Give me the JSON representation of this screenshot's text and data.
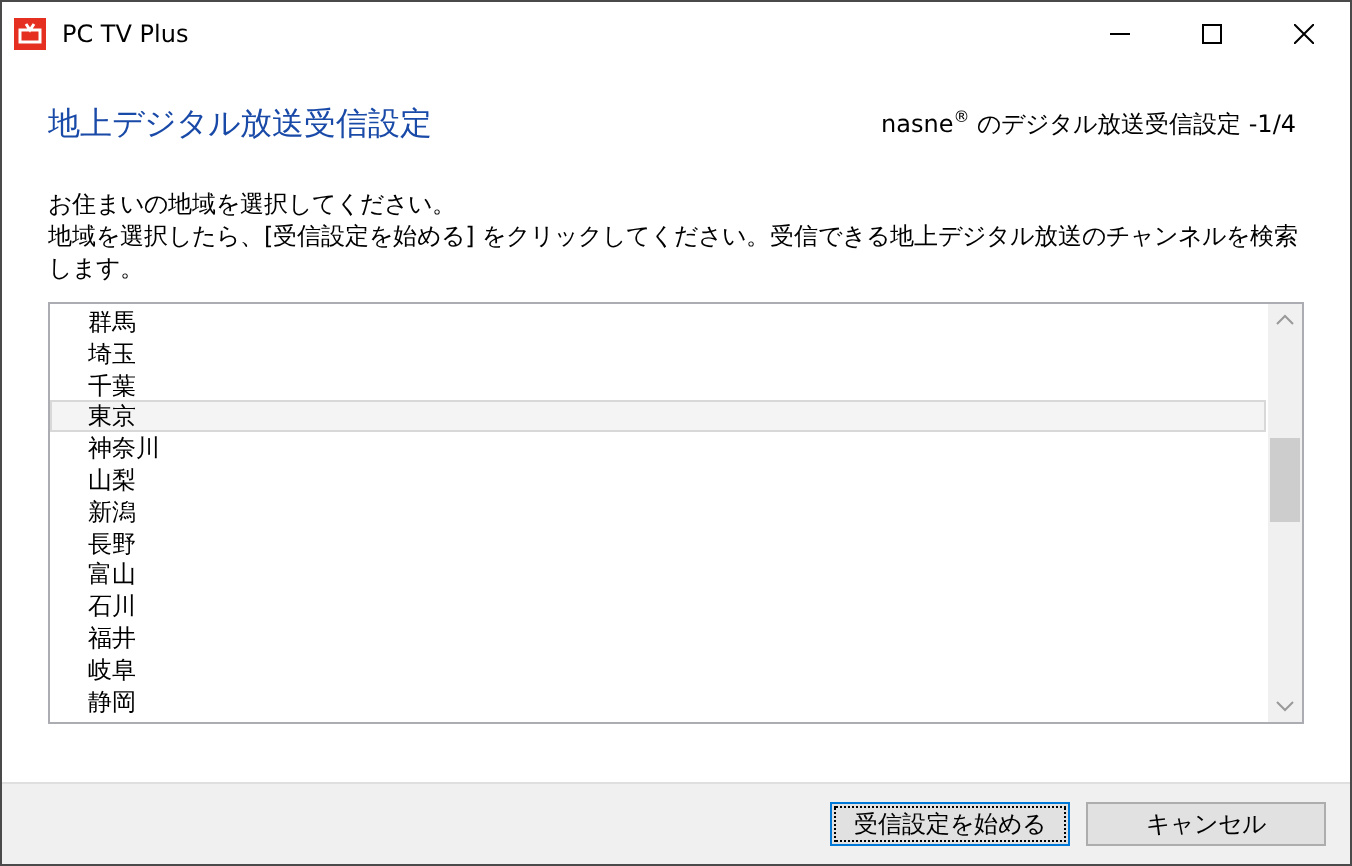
{
  "window": {
    "title": "PC TV Plus"
  },
  "heading": "地上デジタル放送受信設定",
  "step": "nasne$^{®}$ のデジタル放送受信設定 -1/4",
  "instructions": [
    "お住まいの地域を選択してください。",
    "地域を選択したら、[受信設定を始める] をクリックしてください。受信できる地上デジタル放送のチャンネルを検索します。"
  ],
  "regions": [
    {
      "label": "群馬",
      "selected": false
    },
    {
      "label": "埼玉",
      "selected": false
    },
    {
      "label": "千葉",
      "selected": false
    },
    {
      "label": "東京",
      "selected": true
    },
    {
      "label": "神奈川",
      "selected": false
    },
    {
      "label": "山梨",
      "selected": false
    },
    {
      "label": "新潟",
      "selected": false
    },
    {
      "label": "長野",
      "selected": false
    },
    {
      "label": "富山",
      "selected": false
    },
    {
      "label": "石川",
      "selected": false
    },
    {
      "label": "福井",
      "selected": false
    },
    {
      "label": "岐阜",
      "selected": false
    },
    {
      "label": "静岡",
      "selected": false
    }
  ],
  "buttons": [
    {
      "label": "受信設定を始める",
      "focused": true
    },
    {
      "label": "キャンセル",
      "focused": false
    }
  ]
}
